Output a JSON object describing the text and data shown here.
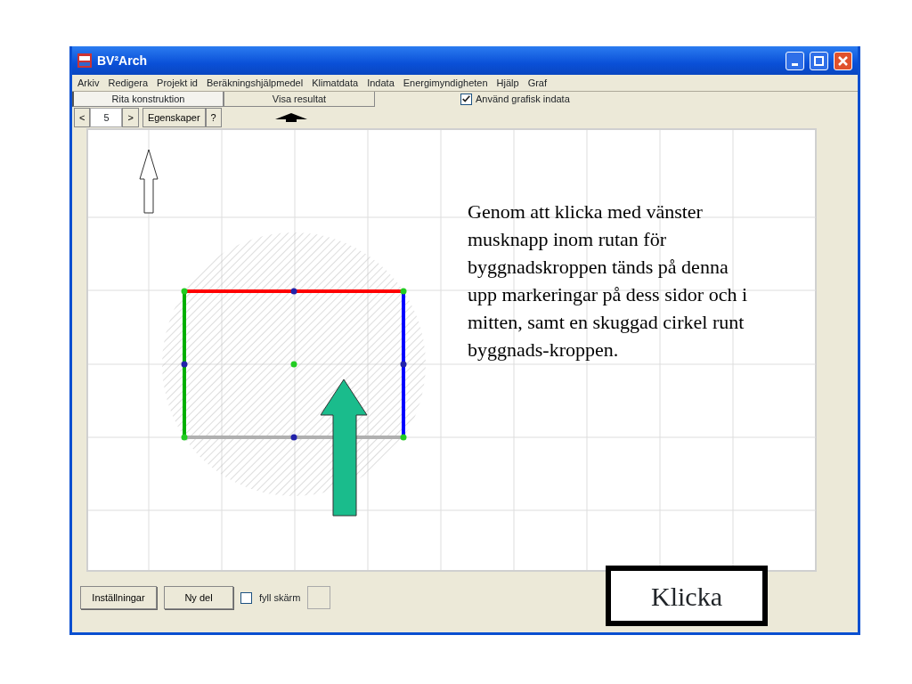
{
  "window": {
    "title": "BV²Arch"
  },
  "menu": [
    "Arkiv",
    "Redigera",
    "Projekt id",
    "Beräkningshjälpmedel",
    "Klimatdata",
    "Indata",
    "Energimyndigheten",
    "Hjälp",
    "Graf"
  ],
  "tabs": [
    {
      "label": "Rita konstruktion",
      "selected": true
    },
    {
      "label": "Visa resultat",
      "selected": false
    }
  ],
  "graphic_input": {
    "label": "Använd grafisk indata",
    "checked": true
  },
  "toolbar": {
    "prev": "<",
    "page": "5",
    "next": ">",
    "properties": "Egenskaper",
    "help": "?"
  },
  "canvas": {
    "edges": [
      {
        "color": "#ff0000"
      },
      {
        "color": "#00b000"
      },
      {
        "color": "#0000ff"
      },
      {
        "color": "#b0b0b0"
      }
    ],
    "annotation": "Genom att klicka med vänster musknapp inom rutan för byggnadskroppen tänds på denna upp markeringar på dess sidor och i mitten, samt en skuggad cirkel runt byggnads-kroppen."
  },
  "bottom": {
    "buttons": [
      "Inställningar",
      "Ny del"
    ],
    "fill_screen": {
      "label": "fyll skärm",
      "checked": false
    }
  },
  "callout": "Klicka"
}
